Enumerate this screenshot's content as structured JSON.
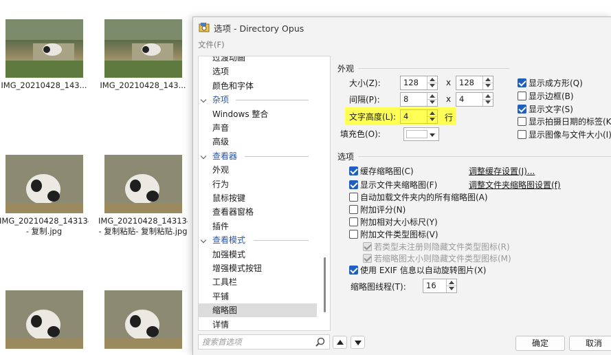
{
  "explorer": {
    "thumbnails": [
      {
        "caption_line1": "IMG_20210428_143...",
        "caption_line2": ""
      },
      {
        "caption_line1": "IMG_20210428_143...",
        "caption_line2": ""
      },
      {
        "caption_line1": "IMG_20210428_143134",
        "caption_line2": "- 复制.jpg"
      },
      {
        "caption_line1": "IMG_20210428_143134",
        "caption_line2": "- 复制粘贴- 复制粘贴.jpg"
      },
      {
        "caption_line1": "",
        "caption_line2": ""
      },
      {
        "caption_line1": "",
        "caption_line2": ""
      }
    ]
  },
  "dialog": {
    "title": "选项 - Directory Opus",
    "menu_file": "文件(F)",
    "tree": {
      "items": [
        {
          "type": "item",
          "label": "过渡动画"
        },
        {
          "type": "item",
          "label": "选项"
        },
        {
          "type": "item",
          "label": "颜色和字体"
        },
        {
          "type": "cat",
          "label": "杂项"
        },
        {
          "type": "item",
          "label": "Windows 整合"
        },
        {
          "type": "item",
          "label": "声音"
        },
        {
          "type": "item",
          "label": "高级"
        },
        {
          "type": "cat",
          "label": "查看器"
        },
        {
          "type": "item",
          "label": "外观"
        },
        {
          "type": "item",
          "label": "行为"
        },
        {
          "type": "item",
          "label": "鼠标按键"
        },
        {
          "type": "item",
          "label": "查看器窗格"
        },
        {
          "type": "item",
          "label": "插件"
        },
        {
          "type": "cat",
          "label": "查看模式"
        },
        {
          "type": "item",
          "label": "加强模式"
        },
        {
          "type": "item",
          "label": "增强模式按钮"
        },
        {
          "type": "item",
          "label": "工具栏"
        },
        {
          "type": "item",
          "label": "平铺"
        },
        {
          "type": "item",
          "label": "缩略图",
          "selected": true
        },
        {
          "type": "item",
          "label": "详情"
        }
      ]
    },
    "search_placeholder": "搜索首选项",
    "appearance": {
      "title": "外观",
      "size_label": "大小(Z):",
      "size_w": "128",
      "size_h": "128",
      "spacing_label": "间隔(P):",
      "spacing_w": "8",
      "spacing_h": "4",
      "x_sep": "x",
      "text_height_label": "文字高度(L):",
      "text_height_value": "4",
      "text_height_unit": "行",
      "fill_label": "填充色(O):",
      "fill_color": "#ffffff",
      "checks": [
        {
          "label": "显示成方形(Q)",
          "checked": true
        },
        {
          "label": "显示边框(B)",
          "checked": false
        },
        {
          "label": "显示文字(S)",
          "checked": true
        },
        {
          "label": "显示拍摄日期的标签(K)",
          "checked": false
        },
        {
          "label": "显示图像与文件大小(I)",
          "checked": false
        }
      ]
    },
    "options": {
      "title": "选项",
      "cache": {
        "label": "缓存缩略图(C)",
        "checked": true
      },
      "cache_link": "调整缓存设置(J)...",
      "folder": {
        "label": "显示文件夹缩略图(F)",
        "checked": true
      },
      "folder_link": "调整文件夹缩略图设置(f)",
      "auto_load": {
        "label": "自动加载文件夹内的所有缩略图(A)",
        "checked": false
      },
      "rating": {
        "label": "附加评分(N)",
        "checked": false
      },
      "rel_size": {
        "label": "附加相对大小标尺(Y)",
        "checked": false
      },
      "type_icon": {
        "label": "附加文件类型图标(V)",
        "checked": false
      },
      "hide_unreg": {
        "label": "若类型未注册则隐藏文件类型图标(R)",
        "checked": true
      },
      "hide_small": {
        "label": "若缩略图太小则隐藏文件类型图标(M)",
        "checked": true
      },
      "exif": {
        "label": "使用 EXIF 信息以自动旋转图片(X)",
        "checked": true
      },
      "threads_label": "缩略图线程(T):",
      "threads_value": "16"
    },
    "ok_label": "确定",
    "cancel_label": "取消"
  }
}
